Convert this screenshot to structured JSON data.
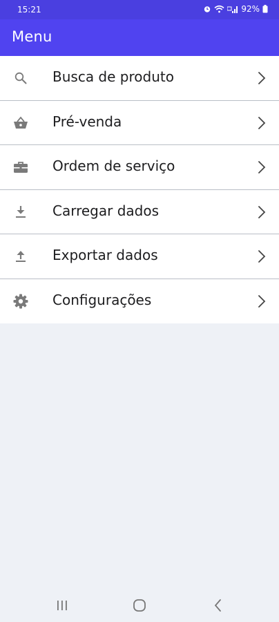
{
  "status_bar": {
    "time": "15:21",
    "battery": "92%",
    "icons": [
      "alarm-icon",
      "wifi-icon",
      "signal-icon",
      "battery-icon"
    ]
  },
  "app_bar": {
    "title": "Menu",
    "color": "#5043f0"
  },
  "menu": {
    "items": [
      {
        "label": "Busca de produto",
        "icon": "search-icon"
      },
      {
        "label": "Pré-venda",
        "icon": "basket-icon"
      },
      {
        "label": "Ordem de serviço",
        "icon": "toolbox-icon"
      },
      {
        "label": "Carregar dados",
        "icon": "download-icon"
      },
      {
        "label": "Exportar dados",
        "icon": "upload-icon"
      },
      {
        "label": "Configurações",
        "icon": "gear-icon"
      }
    ]
  },
  "nav_bar": {
    "buttons": [
      "recent-apps-icon",
      "home-icon",
      "back-icon"
    ]
  }
}
